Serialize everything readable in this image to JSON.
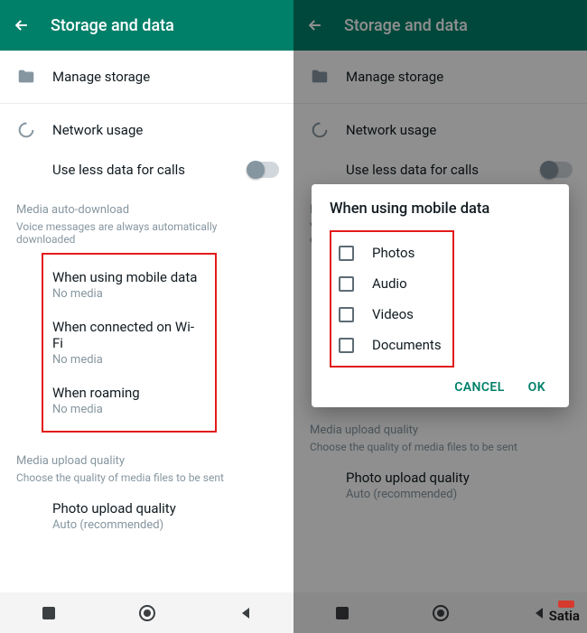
{
  "appbar": {
    "title": "Storage and data"
  },
  "rows": {
    "manage_storage": "Manage storage",
    "network_usage": "Network usage",
    "less_data": "Use less data for calls"
  },
  "media_auto": {
    "header": "Media auto-download",
    "sub": "Voice messages are always automatically downloaded",
    "items": [
      {
        "label": "When using mobile data",
        "sub": "No media"
      },
      {
        "label": "When connected on Wi-Fi",
        "sub": "No media"
      },
      {
        "label": "When roaming",
        "sub": "No media"
      }
    ]
  },
  "upload": {
    "header": "Media upload quality",
    "sub": "Choose the quality of media files to be sent",
    "item_label": "Photo upload quality",
    "item_sub": "Auto (recommended)"
  },
  "dialog": {
    "title": "When using mobile data",
    "options": [
      "Photos",
      "Audio",
      "Videos",
      "Documents"
    ],
    "cancel": "CANCEL",
    "ok": "OK"
  },
  "watermark": "Satia"
}
